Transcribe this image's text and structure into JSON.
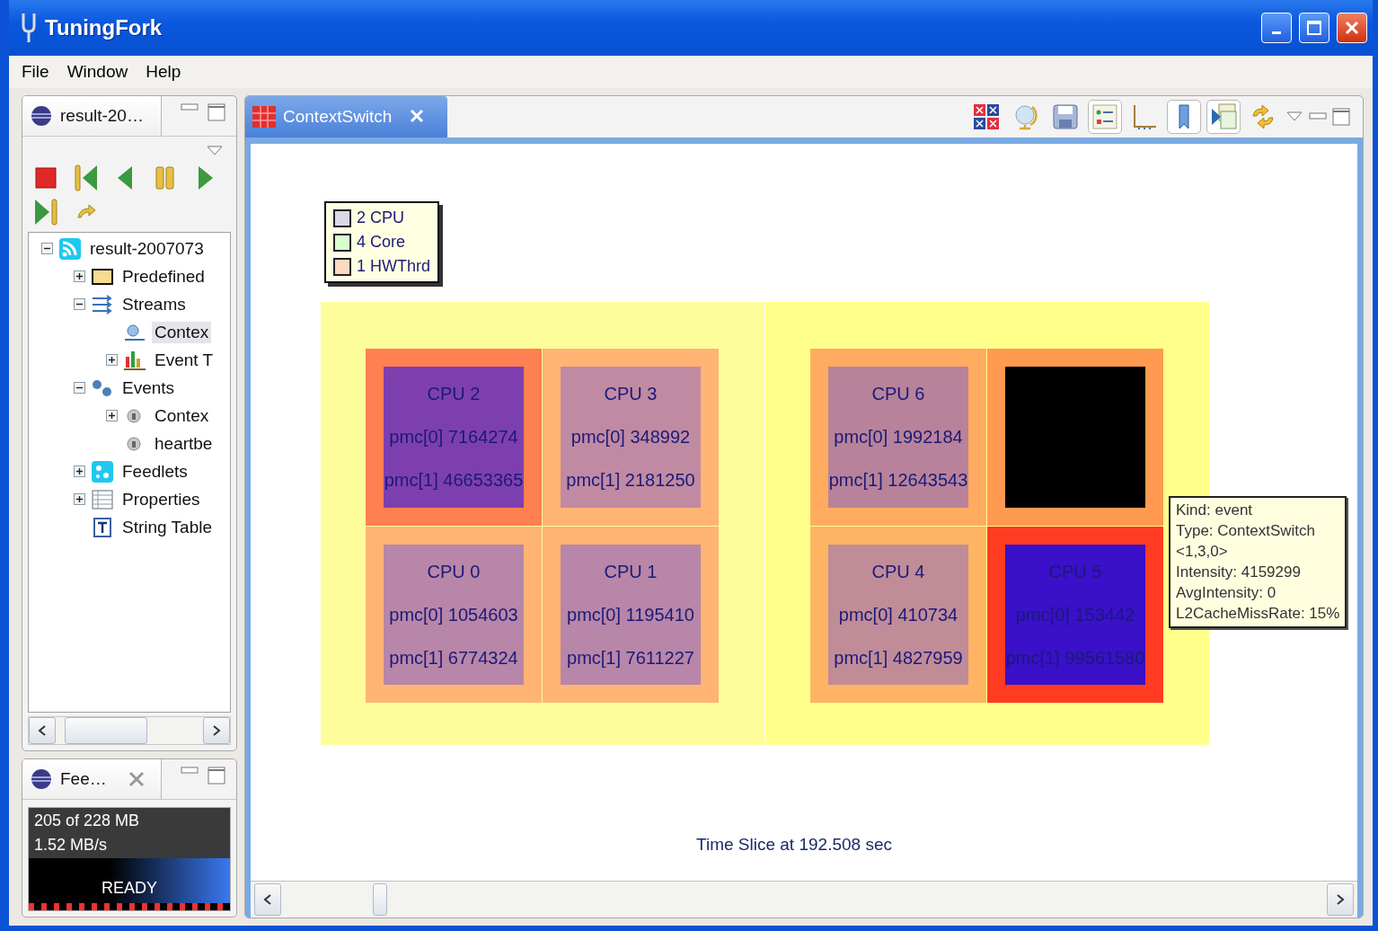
{
  "window": {
    "title": "TuningFork"
  },
  "menu": [
    "File",
    "Window",
    "Help"
  ],
  "explorer": {
    "tab": "result-20…",
    "controls": [
      {
        "kind": "stop"
      },
      {
        "kind": "first"
      },
      {
        "kind": "back"
      },
      {
        "kind": "pause"
      },
      {
        "kind": "play"
      },
      {
        "kind": "last"
      },
      {
        "kind": "jump"
      }
    ],
    "tree": [
      {
        "label": "result-2007073",
        "kind": "feed",
        "expanded": true,
        "selected": false,
        "children": [
          {
            "label": "Predefined",
            "kind": "folder",
            "expanded": false,
            "selected": false
          },
          {
            "label": "Streams",
            "kind": "streams",
            "expanded": true,
            "selected": false,
            "children": [
              {
                "label": "Contex",
                "kind": "stream",
                "selected": true
              },
              {
                "label": "Event T",
                "kind": "chart",
                "expanded": false,
                "selected": false
              }
            ]
          },
          {
            "label": "Events",
            "kind": "events",
            "expanded": true,
            "selected": false,
            "children": [
              {
                "label": "Contex",
                "kind": "event",
                "expanded": false,
                "selected": false
              },
              {
                "label": "heartbe",
                "kind": "event",
                "selected": false
              }
            ]
          },
          {
            "label": "Feedlets",
            "kind": "feedlets",
            "expanded": false,
            "selected": false
          },
          {
            "label": "Properties",
            "kind": "table",
            "expanded": false,
            "selected": false
          },
          {
            "label": "String Table",
            "kind": "text",
            "selected": false
          }
        ]
      }
    ]
  },
  "feedlets": {
    "tab": "Fee…",
    "memory": "205 of 228 MB",
    "rate": "1.52 MB/s",
    "status": "READY"
  },
  "editor": {
    "tab": "ContextSwitch",
    "toolbar": [
      {
        "kind": "grid",
        "pressed": false
      },
      {
        "kind": "globe",
        "pressed": false
      },
      {
        "kind": "save",
        "pressed": false
      },
      {
        "kind": "legend",
        "pressed": true
      },
      {
        "kind": "axes",
        "pressed": false
      },
      {
        "kind": "bookmark",
        "pressed": true
      },
      {
        "kind": "play-chart",
        "pressed": true
      },
      {
        "kind": "refresh",
        "pressed": false
      }
    ],
    "legend": [
      {
        "label": "2 CPU",
        "color": "#d8d8e6"
      },
      {
        "label": "4 Core",
        "color": "#d8ffd0"
      },
      {
        "label": "1 HWThrd",
        "color": "#ffd8c0"
      }
    ],
    "groups": [
      {
        "cells": [
          {
            "label": "CPU 2",
            "pmc0": "pmc[0] 7164274",
            "pmc1": "pmc[1] 46653365",
            "color": "#ff8050",
            "tile": {
              "color": "#7e3fae"
            }
          },
          {
            "label": "CPU 3",
            "pmc0": "pmc[0] 348992",
            "pmc1": "pmc[1] 2181250",
            "color": "#ffb474",
            "tile": {
              "color": "#c08aa2"
            }
          },
          {
            "label": "CPU 0",
            "pmc0": "pmc[0] 1054603",
            "pmc1": "pmc[1] 6774324",
            "color": "#ffb474",
            "tile": {
              "color": "#b886a8"
            }
          },
          {
            "label": "CPU 1",
            "pmc0": "pmc[0] 1195410",
            "pmc1": "pmc[1] 7611227",
            "color": "#ffb474",
            "tile": {
              "color": "#b886a8"
            }
          }
        ]
      },
      {
        "cells": [
          {
            "label": "CPU 6",
            "pmc0": "pmc[0] 1992184",
            "pmc1": "pmc[1] 12643543",
            "color": "#ffac60",
            "tile": {
              "color": "#b8829a"
            }
          },
          {
            "color": "#ff9a50",
            "tile": {
              "color": "#000000"
            }
          },
          {
            "label": "CPU 4",
            "pmc0": "pmc[0] 410734",
            "pmc1": "pmc[1] 4827959",
            "color": "#ffb464",
            "tile": {
              "color": "#c08c98"
            }
          },
          {
            "label": "CPU 5",
            "pmc0": "pmc[0] 153442",
            "pmc1": "pmc[1] 99561580",
            "color": "#ff3c22",
            "tile": {
              "color": "#3a10c8"
            }
          }
        ]
      }
    ],
    "tooltip": [
      "Kind: event",
      "Type: ContextSwitch",
      "<1,3,0>",
      "Intensity: 4159299",
      "AvgIntensity: 0",
      "L2CacheMissRate: 15%"
    ],
    "caption": "Time Slice at 192.508 sec"
  }
}
